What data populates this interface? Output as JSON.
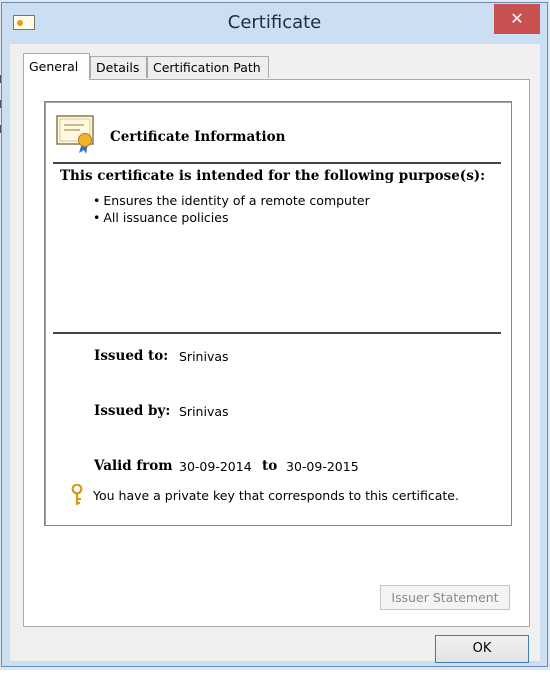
{
  "window": {
    "title": "Certificate",
    "close_glyph": "✕"
  },
  "tabs": [
    {
      "label": "General",
      "active": true
    },
    {
      "label": "Details",
      "active": false
    },
    {
      "label": "Certification Path",
      "active": false
    }
  ],
  "cert": {
    "icon": "certificate-icon",
    "heading": "Certificate Information",
    "purpose_title": "This certificate is intended for the following purpose(s):",
    "purposes": [
      "Ensures the identity of a remote computer",
      "All issuance policies"
    ],
    "issued_to_label": "Issued to:",
    "issued_to": "Srinivas",
    "issued_by_label": "Issued by:",
    "issued_by": "Srinivas",
    "valid_from_label": "Valid from",
    "valid_from": "30-09-2014",
    "to_label": "to",
    "valid_to": "30-09-2015",
    "key_icon": "key-icon",
    "key_text": "You have a private key that corresponds to this certificate."
  },
  "buttons": {
    "issuer_statement": "Issuer Statement",
    "ok": "OK"
  },
  "colors": {
    "close_red": "#c75050",
    "ok_border": "#3c7fb1",
    "frame": "#ccdff2"
  }
}
